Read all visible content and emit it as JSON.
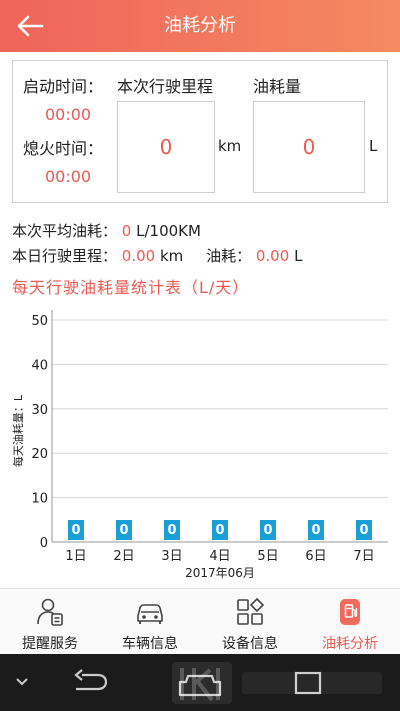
{
  "header": {
    "title": "油耗分析"
  },
  "card": {
    "start_label": "启动时间：",
    "start_value": "00:00",
    "stop_label": "熄火时间：",
    "stop_value": "00:00",
    "mileage_label": "本次行驶里程",
    "mileage_value": "0",
    "mileage_unit": "km",
    "fuel_label": "油耗量",
    "fuel_value": "0",
    "fuel_unit": "L"
  },
  "stats": {
    "avg_label": "本次平均油耗：",
    "avg_value": "0",
    "avg_unit": "L/100KM",
    "day_mileage_label": "本日行驶里程：",
    "day_mileage_value": "0.00",
    "day_mileage_unit": "km",
    "day_fuel_label": "油耗：",
    "day_fuel_value": "0.00",
    "day_fuel_unit": "L"
  },
  "section_title": "每天行驶油耗量统计表（L/天）",
  "chart_data": {
    "type": "bar",
    "ylabel": "每天油耗量：L",
    "xlabel": "2017年06月",
    "categories": [
      "1日",
      "2日",
      "3日",
      "4日",
      "5日",
      "6日",
      "7日"
    ],
    "values": [
      0,
      0,
      0,
      0,
      0,
      0,
      0
    ],
    "data_labels": [
      "0",
      "0",
      "0",
      "0",
      "0",
      "0",
      "0"
    ],
    "yticks": [
      0,
      10,
      20,
      30,
      40,
      50
    ],
    "ylim": [
      0,
      50
    ],
    "grid": true,
    "bar_color": "#1a9fd8"
  },
  "nav": {
    "items": [
      {
        "label": "提醒服务",
        "icon": "user-reminder-icon"
      },
      {
        "label": "车辆信息",
        "icon": "car-icon"
      },
      {
        "label": "设备信息",
        "icon": "grid-icon"
      },
      {
        "label": "油耗分析",
        "icon": "fuel-icon"
      }
    ],
    "active_index": 3
  },
  "colors": {
    "accent": "#ee5a52",
    "header_start": "#f0645a",
    "header_end": "#f48a62"
  }
}
